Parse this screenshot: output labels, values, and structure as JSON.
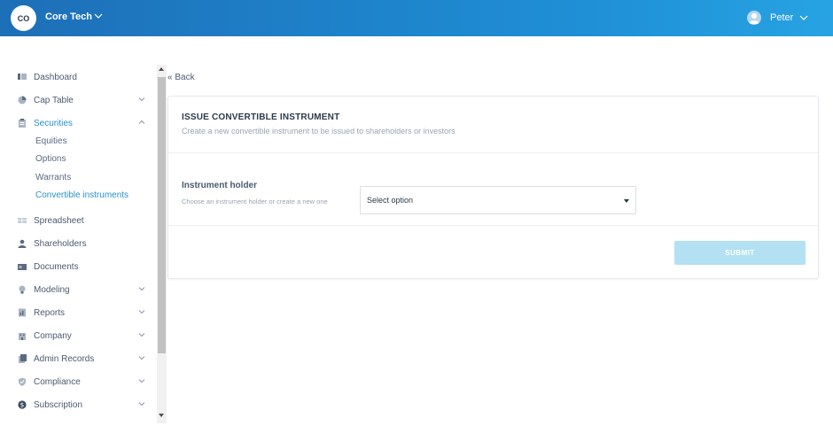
{
  "header": {
    "org_initials": "CO",
    "org_name": "Core Tech",
    "user_name": "Peter"
  },
  "colors": {
    "header_gradient_start": "#1d6fb7",
    "header_gradient_end": "#27a3e3",
    "accent": "#2a8fd0",
    "submit_disabled": "#b3e0f2"
  },
  "sidebar": {
    "items": [
      {
        "label": "Dashboard",
        "icon": "dashboard-icon"
      },
      {
        "label": "Cap Table",
        "icon": "pie-chart-icon",
        "expandable": true
      },
      {
        "label": "Securities",
        "icon": "clipboard-icon",
        "expandable": true,
        "expanded": true,
        "active": true
      },
      {
        "label": "Spreadsheet",
        "icon": "spreadsheet-icon"
      },
      {
        "label": "Shareholders",
        "icon": "person-icon"
      },
      {
        "label": "Documents",
        "icon": "folder-icon"
      },
      {
        "label": "Modeling",
        "icon": "lightbulb-icon",
        "expandable": true
      },
      {
        "label": "Reports",
        "icon": "report-icon",
        "expandable": true
      },
      {
        "label": "Company",
        "icon": "building-icon",
        "expandable": true
      },
      {
        "label": "Admin Records",
        "icon": "admin-records-icon",
        "expandable": true
      },
      {
        "label": "Compliance",
        "icon": "shield-check-icon",
        "expandable": true
      },
      {
        "label": "Subscription",
        "icon": "dollar-icon",
        "expandable": true
      }
    ],
    "securities_subitems": [
      {
        "label": "Equities"
      },
      {
        "label": "Options"
      },
      {
        "label": "Warrants"
      },
      {
        "label": "Convertible instruments",
        "active": true
      }
    ]
  },
  "main": {
    "back_label": "Back",
    "card": {
      "title": "ISSUE CONVERTIBLE INSTRUMENT",
      "subtitle": "Create a new convertible instrument to be issued to shareholders or investors",
      "field_label": "Instrument holder",
      "field_help": "Choose an instrument holder or create a new one",
      "select_value": "Select option",
      "submit_label": "SUBMIT"
    }
  }
}
